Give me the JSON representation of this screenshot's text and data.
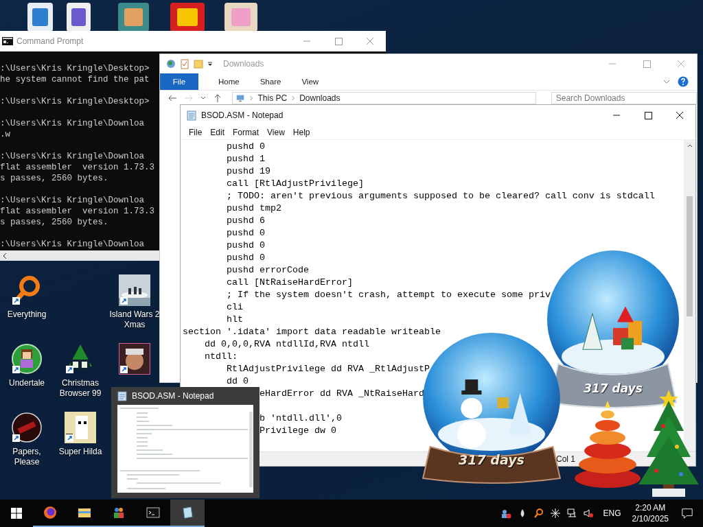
{
  "desktop_icons": [
    {
      "label": "Everything",
      "kind": "magnifier"
    },
    {
      "label": "Island Wars 2 Xmas",
      "kind": "island"
    },
    {
      "label": "Undertale",
      "kind": "character"
    },
    {
      "label": "Christmas Browser 99",
      "kind": "tree99"
    },
    {
      "kind": "portrait"
    },
    {
      "label": "Papers, Please",
      "kind": "seal"
    },
    {
      "label": "Super Hilda",
      "kind": "pixel"
    }
  ],
  "command_prompt": {
    "title": "Command Prompt",
    "blocks": [
      [
        ":\\Users\\Kris Kringle\\Desktop>",
        "he system cannot find the pat"
      ],
      [
        ":\\Users\\Kris Kringle\\Desktop>"
      ],
      [
        ":\\Users\\Kris Kringle\\Downloa",
        ".w"
      ],
      [
        ":\\Users\\Kris Kringle\\Downloa",
        "flat assembler  version 1.73.3",
        "s passes, 2560 bytes."
      ],
      [
        ":\\Users\\Kris Kringle\\Downloa",
        "flat assembler  version 1.73.3",
        "s passes, 2560 bytes."
      ],
      [
        ":\\Users\\Kris Kringle\\Downloa"
      ]
    ]
  },
  "explorer": {
    "title": "Downloads",
    "ribbon_tabs": [
      {
        "label": "File",
        "kind": "backstage"
      },
      {
        "label": "Home",
        "kind": "tab"
      },
      {
        "label": "Share",
        "kind": "tab"
      },
      {
        "label": "View",
        "kind": "tab"
      }
    ],
    "path": [
      "This PC",
      "Downloads"
    ],
    "search": {
      "placeholder": "Search Downloads"
    }
  },
  "notepad": {
    "title": "BSOD.ASM - Notepad",
    "menu": [
      "File",
      "Edit",
      "Format",
      "View",
      "Help"
    ],
    "blocks": [
      [
        "        pushd 0",
        "        pushd 1",
        "        pushd 19",
        "        call [RtlAdjustPrivilege]",
        "        ; TODO: aren't previous arguments supposed to be cleared? call conv is stdcall",
        "        pushd tmp2",
        "        pushd 6",
        "        pushd 0",
        "        pushd 0",
        "        pushd 0",
        "        pushd errorCode",
        "        call [NtRaiseHardError]",
        "        ; If the system doesn't crash, attempt to execute some priv",
        "        cli",
        "        hlt",
        "section '.idata' import data readable writeable",
        "    dd 0,0,0,RVA ntdllId,RVA ntdll",
        "    ntdll:",
        "        RtlAdjustPrivilege dd RVA _RtlAdjustP",
        "        dd 0",
        "              eHardError dd RVA _NtRaiseHard"
      ],
      [
        "              b 'ntdll.dll',0",
        "              Privilege dw 0"
      ]
    ],
    "status": "Col 1"
  },
  "widgets": [
    {
      "kind": "silverglobe",
      "caption": "317 days"
    },
    {
      "kind": "woodglobe",
      "caption": "317 days"
    },
    {
      "kind": "spiral_tree"
    },
    {
      "kind": "christmas_tree"
    }
  ],
  "thumbnail": {
    "title": "BSOD.ASM - Notepad"
  },
  "taskbar": {
    "apps": [
      {
        "kind": "firefox",
        "running": true,
        "active": false
      },
      {
        "kind": "folder",
        "running": true,
        "active": false
      },
      {
        "kind": "people",
        "running": true,
        "active": false
      },
      {
        "kind": "console",
        "running": true,
        "active": false
      },
      {
        "kind": "notepad",
        "running": true,
        "active": true
      }
    ],
    "language": "ENG",
    "time": "2:20 AM",
    "date": "2/10/2025"
  }
}
